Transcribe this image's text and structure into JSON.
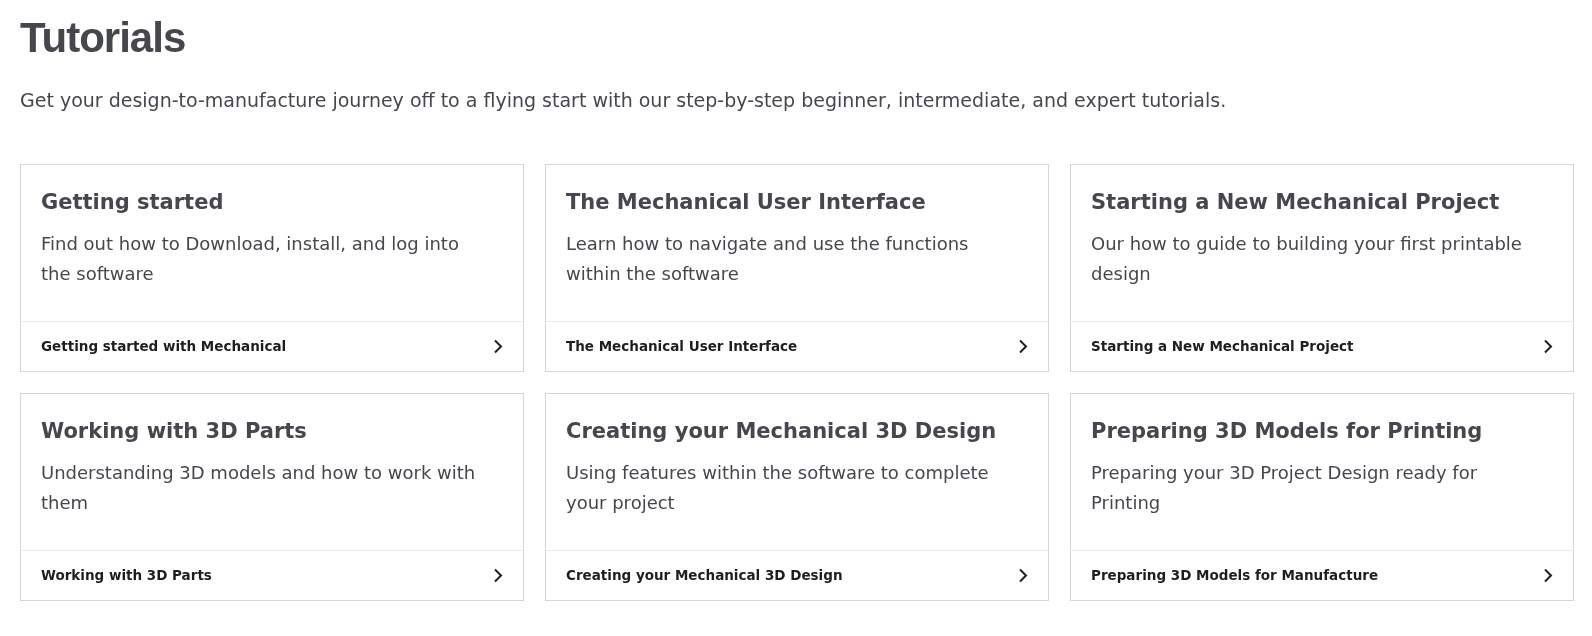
{
  "page": {
    "title": "Tutorials",
    "subtitle": "Get your design-to-manufacture journey off to a flying start with our step-by-step beginner, intermediate, and expert tutorials."
  },
  "cards": [
    {
      "title": "Getting started",
      "description": "Find out how to Download, install, and log into the software",
      "link": "Getting started with Mechanical"
    },
    {
      "title": "The Mechanical User Interface",
      "description": "Learn how to navigate and use the functions within the software",
      "link": "The Mechanical User Interface"
    },
    {
      "title": "Starting a New Mechanical Project",
      "description": "Our how to guide to building your first printable design",
      "link": "Starting a New Mechanical Project"
    },
    {
      "title": "Working with 3D Parts",
      "description": "Understanding 3D models and how to work with them",
      "link": "Working with 3D Parts"
    },
    {
      "title": "Creating your Mechanical 3D Design",
      "description": "Using features within the software to complete your project",
      "link": "Creating your Mechanical 3D Design"
    },
    {
      "title": "Preparing 3D Models for Printing",
      "description": "Preparing your 3D Project Design ready for Printing",
      "link": "Preparing 3D Models for Manufacture"
    }
  ]
}
